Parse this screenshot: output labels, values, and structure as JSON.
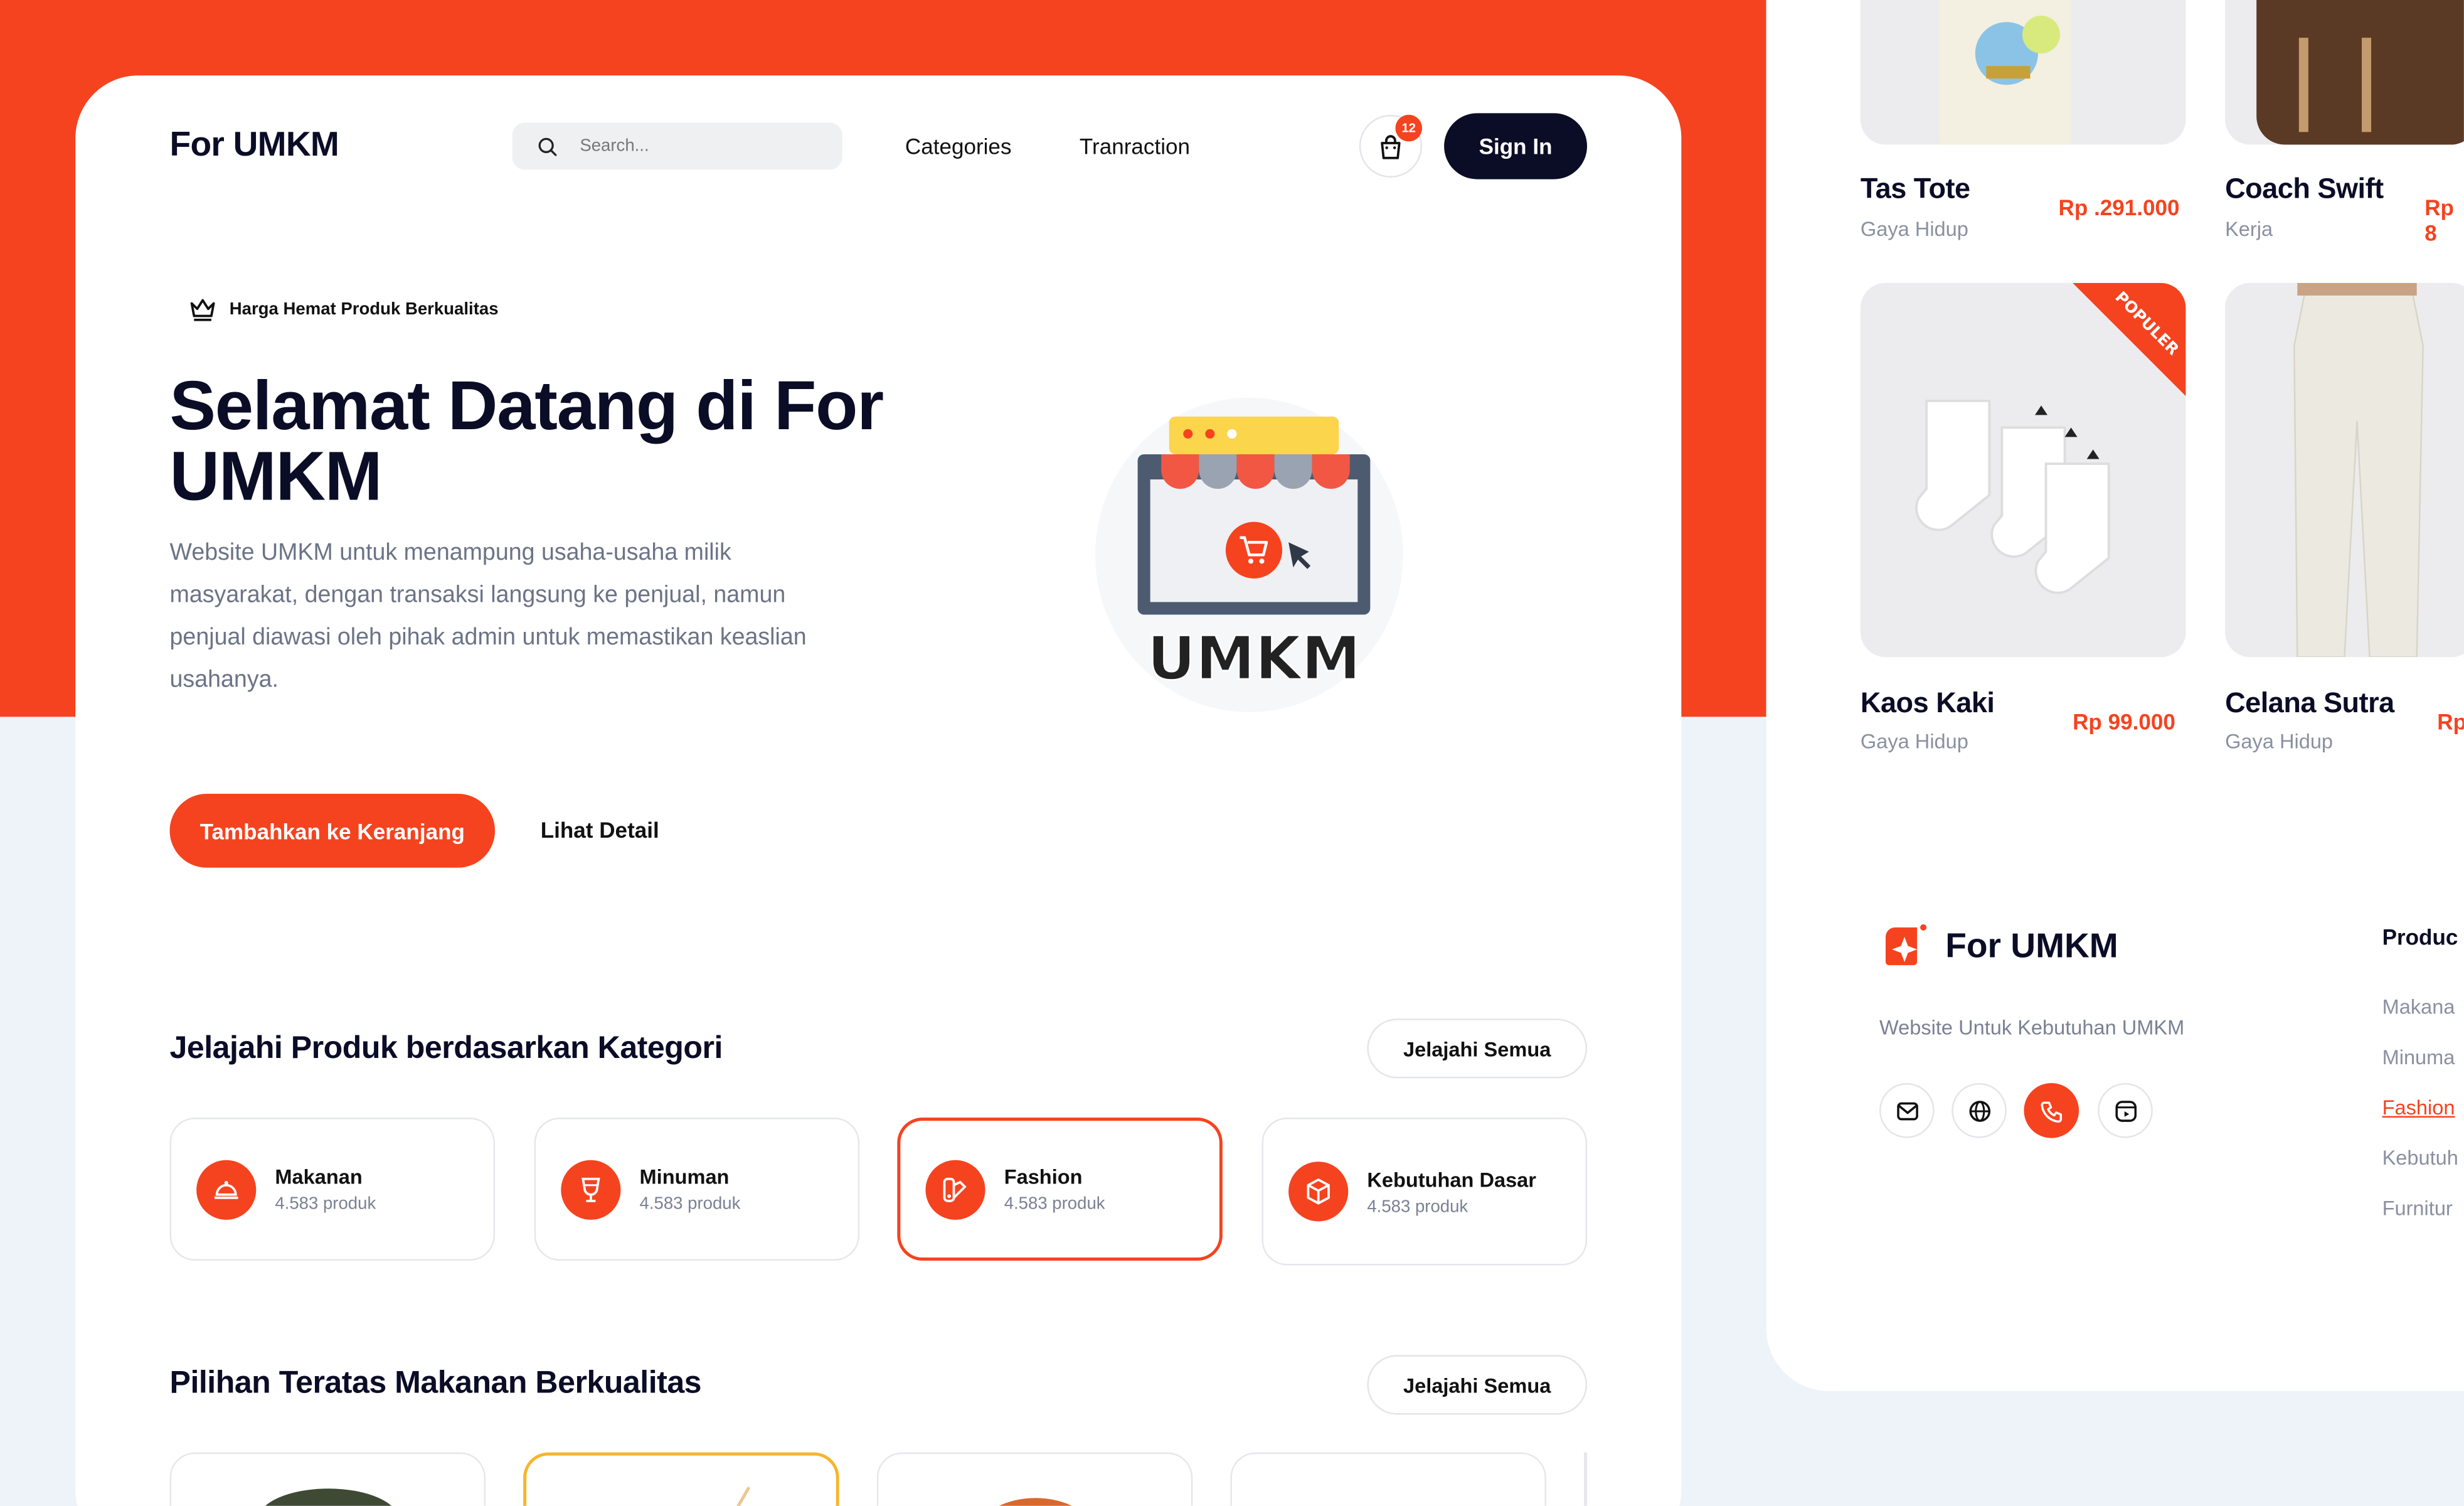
{
  "header": {
    "logo": "For UMKM",
    "search_placeholder": "Search...",
    "nav": [
      "Categories",
      "Tranraction"
    ],
    "cart_count": "12",
    "sign_in": "Sign In"
  },
  "hero": {
    "badge": "Harga Hemat Produk Berkualitas",
    "title": "Selamat Datang di For UMKM",
    "description": "Website UMKM untuk menampung usaha-usaha milik masyarakat, dengan transaksi langsung ke penjual, namun penjual diawasi oleh pihak admin untuk memastikan keaslian usahanya.",
    "primary_button": "Tambahkan ke Keranjang",
    "secondary_button": "Lihat Detail",
    "illustration_label": "UMKM"
  },
  "categories": {
    "title": "Jelajahi Produk berdasarkan Kategori",
    "explore": "Jelajahi Semua",
    "items": [
      {
        "name": "Makanan",
        "count": "4.583 produk",
        "icon": "food-cloche-icon"
      },
      {
        "name": "Minuman",
        "count": "4.583 produk",
        "icon": "drink-glass-icon"
      },
      {
        "name": "Fashion",
        "count": "4.583 produk",
        "icon": "fashion-swatch-icon"
      },
      {
        "name": "Kebutuhan Dasar",
        "count": "4.583 produk",
        "icon": "box-icon"
      }
    ]
  },
  "top_picks": {
    "title": "Pilihan Teratas Makanan Berkualitas",
    "explore": "Jelajahi Semua"
  },
  "products": [
    {
      "name": "Tas Tote",
      "category": "Gaya Hidup",
      "price": "Rp .291.000"
    },
    {
      "name": "Coach Swift",
      "category": "Kerja",
      "price": "Rp 8"
    },
    {
      "name": "Kaos Kaki",
      "category": "Gaya Hidup",
      "price": "Rp 99.000",
      "ribbon": "POPULER"
    },
    {
      "name": "Celana Sutra",
      "category": "Gaya Hidup",
      "price": "Rp"
    }
  ],
  "footer": {
    "logo": "For UMKM",
    "description": "Website Untuk Kebutuhan UMKM",
    "products_heading": "Produc",
    "links": [
      "Makana",
      "Minuma",
      "Fashion",
      "Kebutuh",
      "Furnitur"
    ]
  },
  "colors": {
    "accent": "#f5431f",
    "dark": "#0b0d27",
    "highlight": "#f7b52c"
  }
}
